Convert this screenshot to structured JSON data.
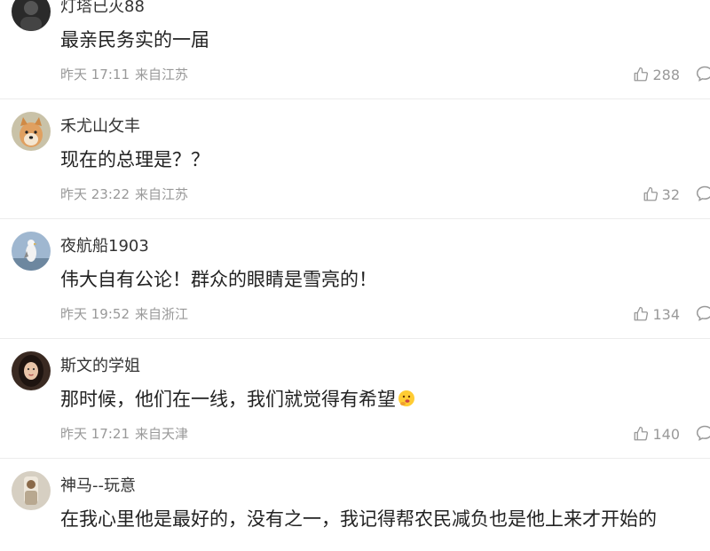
{
  "comments": [
    {
      "username": "灯塔已灭88",
      "content": "最亲民务实的一届",
      "date": "昨天 17:11",
      "location": "来自江苏",
      "likes": "288",
      "avatar_icon": "dark-avatar-icon"
    },
    {
      "username": "禾尤山攵丰",
      "content": "现在的总理是？？",
      "date": "昨天 23:22",
      "location": "来自江苏",
      "likes": "32",
      "avatar_icon": "dog-avatar-icon"
    },
    {
      "username": "夜航船1903",
      "content": "伟大自有公论！群众的眼睛是雪亮的！",
      "date": "昨天 19:52",
      "location": "来自浙江",
      "likes": "134",
      "avatar_icon": "seagull-avatar-icon"
    },
    {
      "username": "斯文的学姐",
      "content": "那时候，他们在一线，我们就觉得有希望",
      "date": "昨天 17:21",
      "location": "来自天津",
      "likes": "140",
      "avatar_icon": "woman-avatar-icon",
      "emoji": "thinking-face-emoji"
    },
    {
      "username": "神马--玩意",
      "content": "在我心里他是最好的，没有之一，我记得帮农民减负也是他上来才开始的",
      "date": "",
      "location": "",
      "likes": "",
      "avatar_icon": "person-avatar-icon"
    }
  ],
  "colors": {
    "text_primary": "#222222",
    "text_username": "#333333",
    "text_meta": "#999999",
    "divider": "#ececec"
  }
}
